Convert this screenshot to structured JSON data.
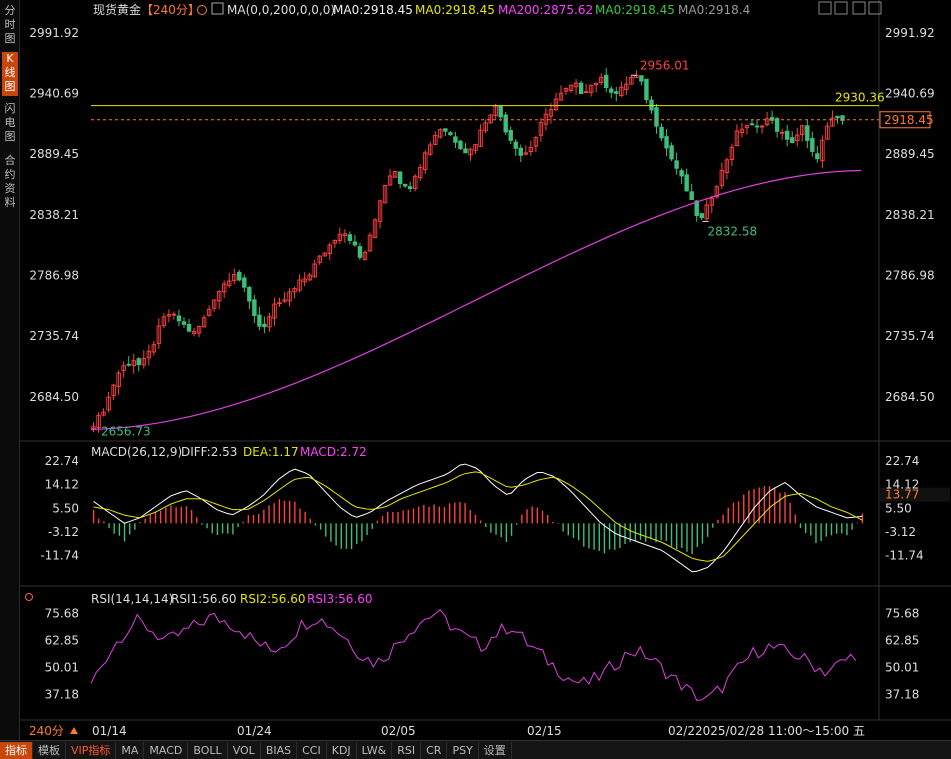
{
  "instrument": {
    "name": "现货黄金",
    "period_tag": "【240分】",
    "ma_params": "MA(0,0,200,0,0,0)",
    "ma_values": [
      "MA0:2918.45",
      "MA0:2918.45",
      "MA200:2875.62",
      "MA0:2918.45",
      "MA0:2918.4"
    ],
    "ma_colors": [
      "#f0f0f0",
      "#e6e600",
      "#ff40ff",
      "#3cc83c",
      "#999999"
    ]
  },
  "left_tabs": [
    {
      "label": "分时图"
    },
    {
      "label": "K线图"
    },
    {
      "label": "闪电图"
    },
    {
      "label": "合约资料"
    }
  ],
  "price_axis": {
    "ticks": [
      "2991.92",
      "2940.69",
      "2889.45",
      "2838.21",
      "2786.98",
      "2735.74",
      "2684.50"
    ]
  },
  "annotations": {
    "high_label": "2956.01",
    "low_label": "2832.58",
    "start_low_label": "2656.73",
    "hline_label": "2930.36",
    "last_price_label": "2918.45",
    "macd_last_label": "13.77"
  },
  "macd_header": {
    "name": "MACD(26,12,9)",
    "diff": "DIFF:2.53",
    "dea": "DEA:1.17",
    "macd": "MACD:2.72"
  },
  "macd_axis": {
    "ticks": [
      "22.74",
      "14.12",
      "5.50",
      "-3.12",
      "-11.74"
    ]
  },
  "rsi_header": {
    "name": "RSI(14,14,14)",
    "rsi1": "RSI1:56.60",
    "rsi2": "RSI2:56.60",
    "rsi3": "RSI3:56.60"
  },
  "rsi_axis": {
    "ticks": [
      "75.68",
      "62.85",
      "50.01",
      "37.18"
    ]
  },
  "date_axis": {
    "labels": [
      "01/14",
      "01/24",
      "02/05",
      "02/15",
      "02/2"
    ],
    "period_label": "240分",
    "cursor_time": "2025/02/28 11:00～15:00 五"
  },
  "bottom_tabs": [
    "指标",
    "模板",
    "VIP指标",
    "MA",
    "MACD",
    "BOLL",
    "VOL",
    "BIAS",
    "CCI",
    "KDJ",
    "LW&",
    "RSI",
    "CR",
    "PSY",
    "设置"
  ],
  "toolbar_icons": [
    "maximize-icon",
    "grid-icon",
    "list-icon",
    "sidebar-icon"
  ],
  "colors": {
    "up": "#ff4040",
    "down": "#3cbf7a",
    "ma200": "#e040e0",
    "hline": "#e6e600",
    "rsi": "#e040e0",
    "diff": "#ffffff",
    "dea": "#e6e600"
  },
  "chart_data": [
    {
      "type": "candlestick",
      "title": "现货黄金 240分",
      "y_ticks": [
        2991.92,
        2940.69,
        2889.45,
        2838.21,
        2786.98,
        2735.74,
        2684.5
      ],
      "ylim": [
        2648,
        3001
      ],
      "close_path": [
        2662,
        2668,
        2680,
        2695,
        2708,
        2712,
        2716,
        2710,
        2718,
        2730,
        2745,
        2755,
        2752,
        2748,
        2742,
        2738,
        2745,
        2755,
        2768,
        2776,
        2783,
        2790,
        2782,
        2768,
        2755,
        2742,
        2748,
        2760,
        2762,
        2770,
        2775,
        2782,
        2786,
        2795,
        2803,
        2810,
        2818,
        2825,
        2822,
        2812,
        2800,
        2812,
        2832,
        2855,
        2870,
        2878,
        2865,
        2858,
        2872,
        2882,
        2895,
        2905,
        2912,
        2908,
        2902,
        2896,
        2890,
        2898,
        2910,
        2922,
        2930,
        2920,
        2905,
        2898,
        2888,
        2892,
        2902,
        2915,
        2925,
        2935,
        2940,
        2945,
        2948,
        2942,
        2946,
        2950,
        2952,
        2946,
        2940,
        2944,
        2952,
        2956,
        2948,
        2932,
        2918,
        2905,
        2890,
        2880,
        2868,
        2855,
        2840,
        2834,
        2848,
        2862,
        2875,
        2890,
        2905,
        2912,
        2915,
        2910,
        2916,
        2920,
        2912,
        2906,
        2898,
        2904,
        2912,
        2895,
        2884,
        2900,
        2915,
        2920,
        2918
      ],
      "high": 2956.01,
      "low": 2832.58,
      "start_low": 2656.73,
      "last": 2918.45,
      "hline": 2930.36,
      "ma200_range": [
        2657,
        2875.62
      ]
    },
    {
      "type": "bar+line",
      "title": "MACD(26,12,9)",
      "y_ticks": [
        22.74,
        14.12,
        5.5,
        -3.12,
        -11.74
      ],
      "ylim": [
        -20,
        25
      ],
      "diff_path": [
        8,
        4,
        0,
        2,
        6,
        10,
        12,
        9,
        5,
        3,
        6,
        10,
        16,
        20,
        18,
        12,
        6,
        2,
        4,
        8,
        11,
        14,
        16,
        18,
        22,
        20,
        14,
        10,
        16,
        19,
        17,
        12,
        6,
        0,
        -4,
        -6,
        -8,
        -10,
        -14,
        -18,
        -16,
        -10,
        -2,
        6,
        12,
        15,
        10,
        6,
        4,
        2,
        2.53
      ],
      "dea_path": [
        6,
        5,
        3,
        2,
        4,
        7,
        9,
        9,
        7,
        5,
        5,
        8,
        12,
        16,
        17,
        14,
        10,
        6,
        5,
        6,
        9,
        11,
        13,
        15,
        18,
        19,
        16,
        13,
        14,
        16,
        17,
        14,
        10,
        5,
        0,
        -3,
        -5,
        -7,
        -10,
        -13,
        -14,
        -12,
        -6,
        0,
        6,
        10,
        11,
        9,
        6,
        4,
        1.17
      ],
      "macd_last": 2.72
    },
    {
      "type": "line",
      "title": "RSI(14,14,14)",
      "y_ticks": [
        75.68,
        62.85,
        50.01,
        37.18
      ],
      "ylim": [
        26,
        82
      ],
      "rsi_path": [
        42,
        55,
        65,
        72,
        68,
        62,
        66,
        70,
        74,
        72,
        68,
        62,
        58,
        62,
        70,
        74,
        70,
        64,
        56,
        52,
        58,
        66,
        72,
        76,
        70,
        64,
        60,
        66,
        70,
        62,
        56,
        50,
        44,
        42,
        46,
        52,
        58,
        56,
        50,
        44,
        38,
        34,
        40,
        48,
        56,
        60,
        58,
        56,
        52,
        48,
        52,
        56.6
      ],
      "last": 56.6
    }
  ]
}
